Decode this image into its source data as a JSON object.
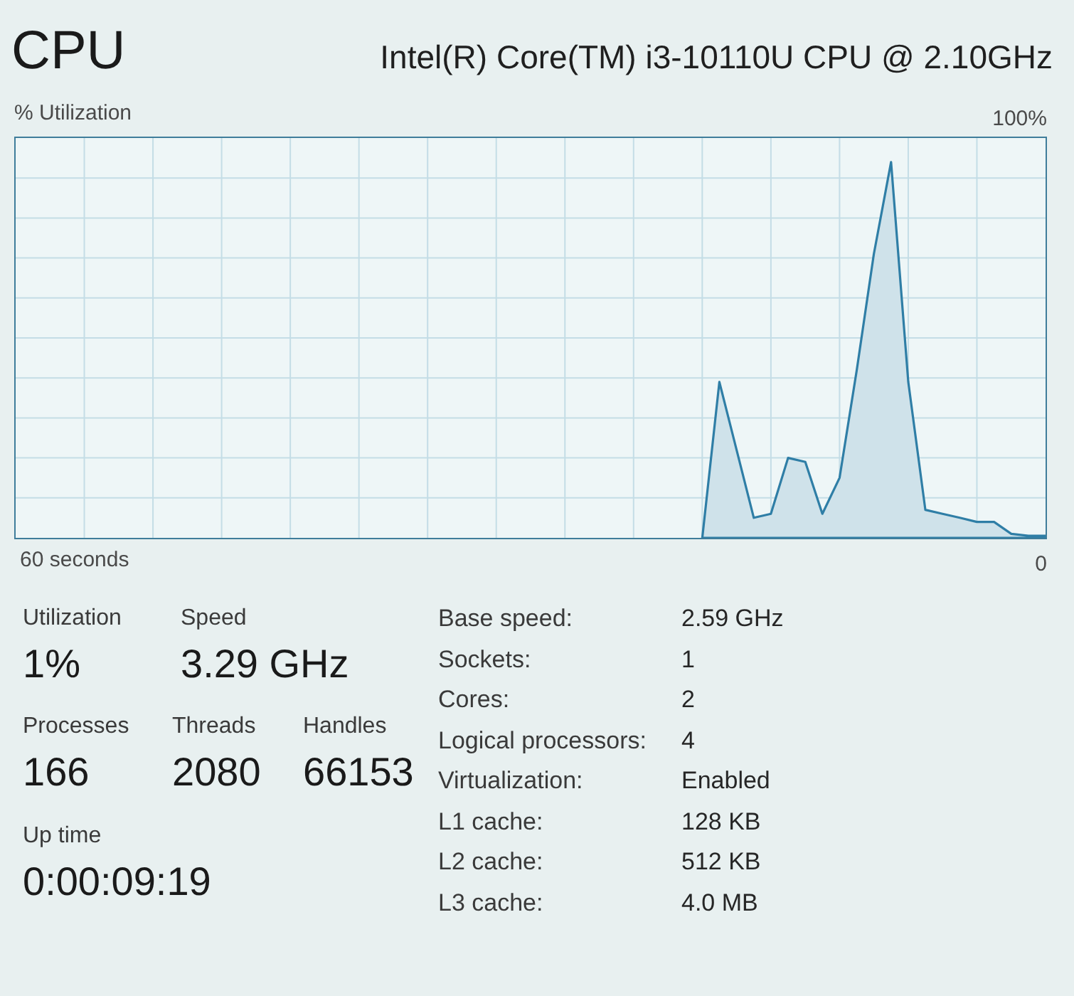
{
  "header": {
    "title": "CPU",
    "processor": "Intel(R) Core(TM) i3-10110U CPU @ 2.10GHz"
  },
  "graph": {
    "y_label": "% Utilization",
    "top_label": "100%",
    "time_label": "60 seconds",
    "bottom_label": "0"
  },
  "stats": [
    {
      "items": [
        {
          "label": "Utilization",
          "value": "1%"
        },
        {
          "label": "Speed",
          "value": "3.29 GHz"
        }
      ]
    },
    {
      "items": [
        {
          "label": "Processes",
          "value": "166"
        },
        {
          "label": "Threads",
          "value": "2080"
        },
        {
          "label": "Handles",
          "value": "66153"
        }
      ]
    },
    {
      "items": [
        {
          "label": "Up time",
          "value": "0:00:09:19"
        }
      ]
    }
  ],
  "details": [
    {
      "label": "Base speed:",
      "value": "2.59 GHz"
    },
    {
      "label": "Sockets:",
      "value": "1"
    },
    {
      "label": "Cores:",
      "value": "2"
    },
    {
      "label": "Logical processors:",
      "value": "4"
    },
    {
      "label": "Virtualization:",
      "value": "Enabled"
    },
    {
      "label": "L1 cache:",
      "value": "128 KB"
    },
    {
      "label": "L2 cache:",
      "value": "512 KB"
    },
    {
      "label": "L3 cache:",
      "value": "4.0 MB"
    }
  ]
}
